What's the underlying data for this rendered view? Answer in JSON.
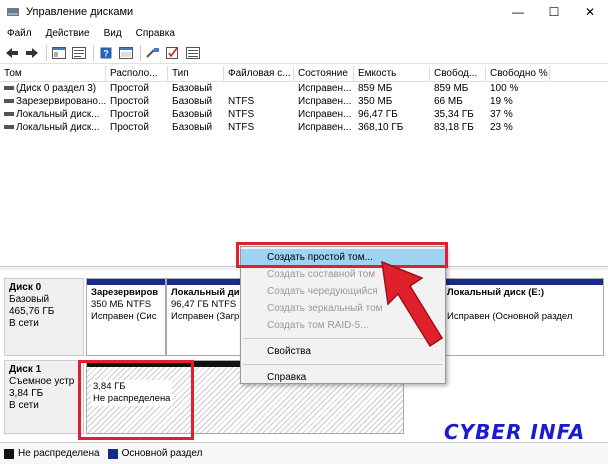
{
  "window": {
    "title": "Управление дисками",
    "minimize": "—",
    "maximize": "☐",
    "close": "✕"
  },
  "menu": [
    "Файл",
    "Действие",
    "Вид",
    "Справка"
  ],
  "table": {
    "headers": [
      "Том",
      "Располо...",
      "Тип",
      "Файловая с...",
      "Состояние",
      "Емкость",
      "Свобод...",
      "Свободно %"
    ],
    "rows": [
      [
        "(Диск 0 раздел 3)",
        "Простой",
        "Базовый",
        "",
        "Исправен...",
        "859 МБ",
        "859 МБ",
        "100 %"
      ],
      [
        "Зарезервировано...",
        "Простой",
        "Базовый",
        "NTFS",
        "Исправен...",
        "350 МБ",
        "66 МБ",
        "19 %"
      ],
      [
        "Локальный диск...",
        "Простой",
        "Базовый",
        "NTFS",
        "Исправен...",
        "96,47 ГБ",
        "35,34 ГБ",
        "37 %"
      ],
      [
        "Локальный диск...",
        "Простой",
        "Базовый",
        "NTFS",
        "Исправен...",
        "368,10 ГБ",
        "83,18 ГБ",
        "23 %"
      ]
    ]
  },
  "disk0": {
    "name": "Диск 0",
    "type": "Базовый",
    "size": "465,76 ГБ",
    "status": "В сети",
    "parts": [
      {
        "title": "Зарезервиров",
        "line2": "350 МБ NTFS",
        "line3": "Исправен (Сис"
      },
      {
        "title": "Локальный ди",
        "line2": "96,47 ГБ NTFS",
        "line3": "Исправен (Загр"
      },
      {
        "title": "Локальный диск  (E:)",
        "line2": "",
        "line3": "Исправен (Основной раздел"
      }
    ]
  },
  "disk1": {
    "name": "Диск 1",
    "type": "Съемное устр",
    "size": "3,84 ГБ",
    "status": "В сети",
    "part": {
      "size": "3,84 ГБ",
      "label": "Не распределена"
    }
  },
  "context_menu": {
    "items": [
      {
        "label": "Создать простой том...",
        "enabled": true
      },
      {
        "label": "Создать составной том",
        "enabled": false
      },
      {
        "label": "Создать чередующийся",
        "enabled": false
      },
      {
        "label": "Создать зеркальный том",
        "enabled": false
      },
      {
        "label": "Создать том RAID-5...",
        "enabled": false
      },
      {
        "label": "Свойства",
        "enabled": true
      },
      {
        "label": "Справка",
        "enabled": true
      }
    ]
  },
  "legend": [
    {
      "label": "Не распределена",
      "color": "#111111"
    },
    {
      "label": "Основной раздел",
      "color": "#1a2a8a"
    }
  ],
  "watermark": "CYBER INFA",
  "colors": {
    "accent_red": "#e0202a",
    "partition_bar": "#1a2a8a",
    "highlight": "#9ed3f2"
  }
}
